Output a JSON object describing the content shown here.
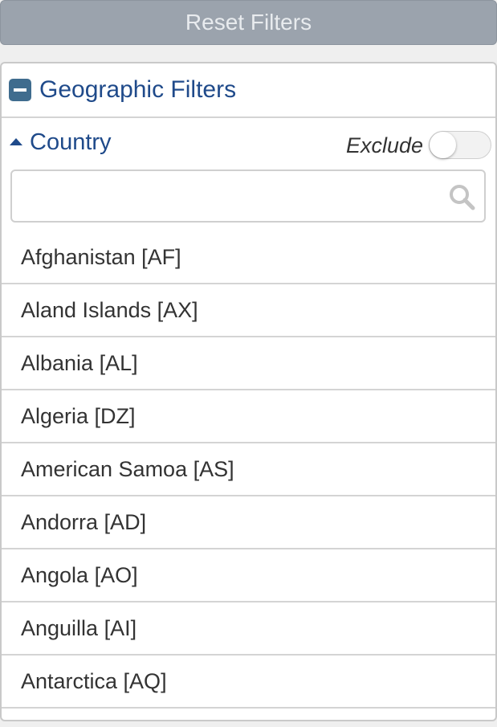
{
  "reset_button": {
    "label": "Reset Filters"
  },
  "panel": {
    "title": "Geographic Filters",
    "icon": "collapse-minus-icon",
    "accent_color": "#1f4a8a"
  },
  "country_section": {
    "title": "Country",
    "exclude_label": "Exclude",
    "exclude_enabled": false,
    "search": {
      "value": "",
      "placeholder": ""
    }
  },
  "countries": [
    {
      "label": "Afghanistan [AF]"
    },
    {
      "label": "Aland Islands [AX]"
    },
    {
      "label": "Albania [AL]"
    },
    {
      "label": "Algeria [DZ]"
    },
    {
      "label": "American Samoa [AS]"
    },
    {
      "label": "Andorra [AD]"
    },
    {
      "label": "Angola [AO]"
    },
    {
      "label": "Anguilla [AI]"
    },
    {
      "label": "Antarctica [AQ]"
    },
    {
      "label": ""
    }
  ]
}
